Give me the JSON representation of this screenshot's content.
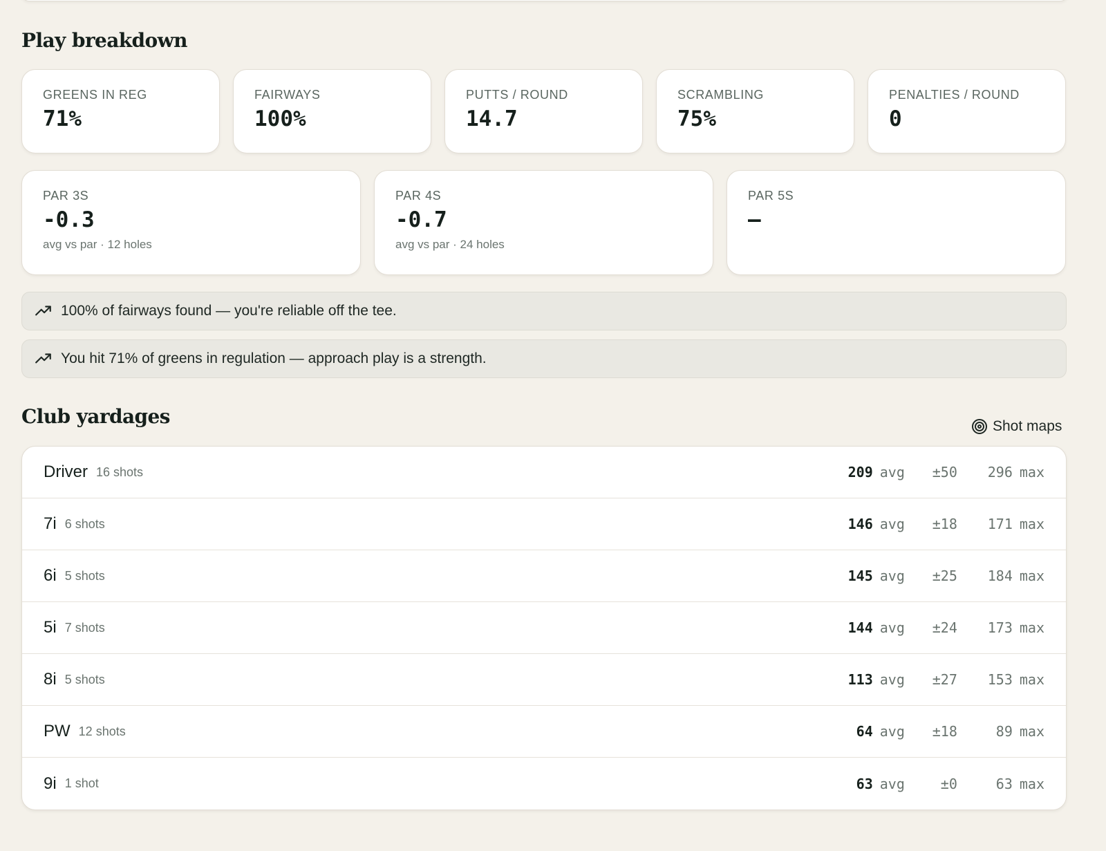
{
  "play_breakdown": {
    "title": "Play breakdown",
    "stats": [
      {
        "label": "GREENS IN REG",
        "value": "71%"
      },
      {
        "label": "FAIRWAYS",
        "value": "100%"
      },
      {
        "label": "PUTTS / ROUND",
        "value": "14.7"
      },
      {
        "label": "SCRAMBLING",
        "value": "75%"
      },
      {
        "label": "PENALTIES / ROUND",
        "value": "0"
      }
    ],
    "par_stats": [
      {
        "label": "PAR 3S",
        "value": "-0.3",
        "sub": "avg vs par · 12 holes"
      },
      {
        "label": "PAR 4S",
        "value": "-0.7",
        "sub": "avg vs par · 24 holes"
      },
      {
        "label": "PAR 5S",
        "value": "–",
        "sub": ""
      }
    ],
    "insights": [
      {
        "text": "100% of fairways found — you're reliable off the tee.",
        "icon": "trending-up-icon"
      },
      {
        "text": "You hit 71% of greens in regulation — approach play is a strength.",
        "icon": "trending-up-icon"
      }
    ]
  },
  "club_yardages": {
    "title": "Club yardages",
    "shot_maps_label": "Shot maps",
    "shot_maps_icon": "target-icon",
    "avg_unit": "avg",
    "max_unit": "max",
    "clubs": [
      {
        "name": "Driver",
        "shots": "16 shots",
        "avg": "209",
        "spread": "±50",
        "max": "296"
      },
      {
        "name": "7i",
        "shots": "6 shots",
        "avg": "146",
        "spread": "±18",
        "max": "171"
      },
      {
        "name": "6i",
        "shots": "5 shots",
        "avg": "145",
        "spread": "±25",
        "max": "184"
      },
      {
        "name": "5i",
        "shots": "7 shots",
        "avg": "144",
        "spread": "±24",
        "max": "173"
      },
      {
        "name": "8i",
        "shots": "5 shots",
        "avg": "113",
        "spread": "±27",
        "max": "153"
      },
      {
        "name": "PW",
        "shots": "12 shots",
        "avg": "64",
        "spread": "±18",
        "max": "89"
      },
      {
        "name": "9i",
        "shots": "1 shot",
        "avg": "63",
        "spread": "±0",
        "max": "63"
      }
    ]
  }
}
